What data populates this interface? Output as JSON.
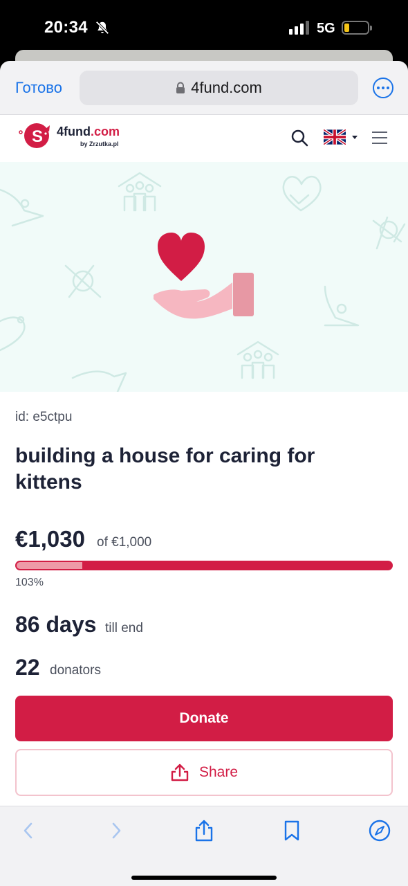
{
  "status_bar": {
    "time": "20:34",
    "network": "5G",
    "icons": [
      "bell-off-icon",
      "signal-icon",
      "battery-low-icon"
    ]
  },
  "browser": {
    "done_label": "Готово",
    "url": "4fund.com",
    "icons": [
      "lock-icon",
      "more-icon"
    ],
    "accent_color": "#1a73e8"
  },
  "site": {
    "logo_main": "4fund",
    "logo_domain": ".com",
    "logo_sub": "by Zrzutka.pl",
    "icons": [
      "search-icon",
      "uk-flag-icon",
      "caret-down-icon",
      "menu-icon"
    ],
    "brand_color": "#d21d45"
  },
  "hero": {
    "icons": [
      "heart-in-hand-icon",
      "community-house-icon",
      "heart-hands-icon",
      "helping-hand-icon",
      "handshake-icon"
    ]
  },
  "fundraiser": {
    "id_text": "id: e5ctpu",
    "title": "building a house for caring for kittens",
    "raised": "€1,030",
    "goal_text": "of €1,000",
    "percent_text": "103%",
    "progress_fraction": 1.03,
    "days_value": "86 days",
    "days_label": "till end",
    "donors_value": "22",
    "donors_label": "donators",
    "donate_label": "Donate",
    "share_label": "Share"
  },
  "toolbar": {
    "icons": [
      "back-icon",
      "forward-icon",
      "share-icon",
      "bookmarks-icon",
      "compass-icon"
    ]
  }
}
